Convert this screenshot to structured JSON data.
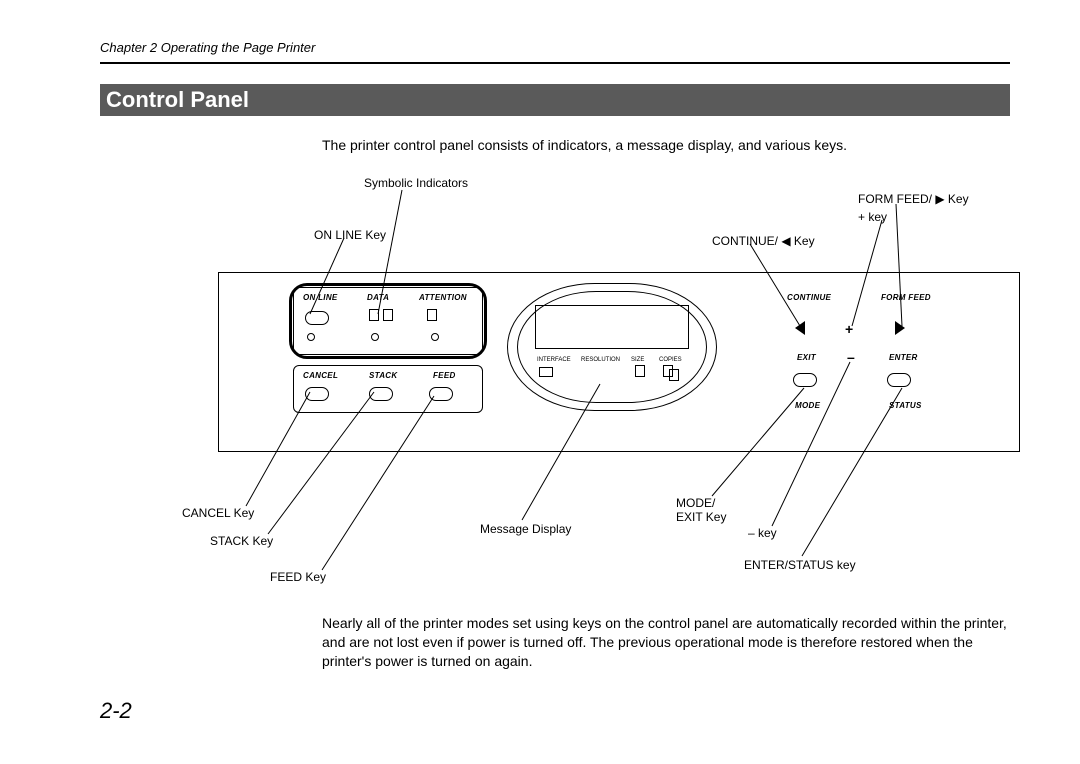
{
  "header": {
    "chapter": "Chapter 2  Operating the Page Printer"
  },
  "title": "Control Panel",
  "intro": "The printer control panel consists of indicators, a message display, and various keys.",
  "callouts": {
    "symbolic": "Symbolic Indicators",
    "online": "ON LINE Key",
    "formfeed": "FORM FEED/ ▶ Key",
    "plus": "+ key",
    "continue": "CONTINUE/ ◀ Key",
    "cancel": "CANCEL Key",
    "stack": "STACK Key",
    "feed": "FEED Key",
    "msg": "Message Display",
    "mode": "MODE/\nEXIT Key",
    "minus": "– key",
    "enter": "ENTER/STATUS key"
  },
  "panel": {
    "top_left": {
      "online": "ON LINE",
      "data": "DATA",
      "attention": "ATTENTION"
    },
    "bot_left": {
      "cancel": "CANCEL",
      "stack": "STACK",
      "feed": "FEED"
    },
    "disp": {
      "interface": "INTERFACE",
      "resolution": "RESOLUTION",
      "size": "SIZE",
      "copies": "COPIES"
    },
    "right": {
      "continue": "CONTINUE",
      "formfeed": "FORM FEED",
      "exit": "EXIT",
      "enter": "ENTER",
      "mode": "MODE",
      "status": "STATUS",
      "plus": "+",
      "minus": "–"
    }
  },
  "outro": "Nearly all of the printer modes set using keys on the control panel are automatically recorded within the printer, and are not lost even if power is turned off.  The previous operational mode is therefore restored when the printer's power is turned on again.",
  "pagenum": "2-2"
}
